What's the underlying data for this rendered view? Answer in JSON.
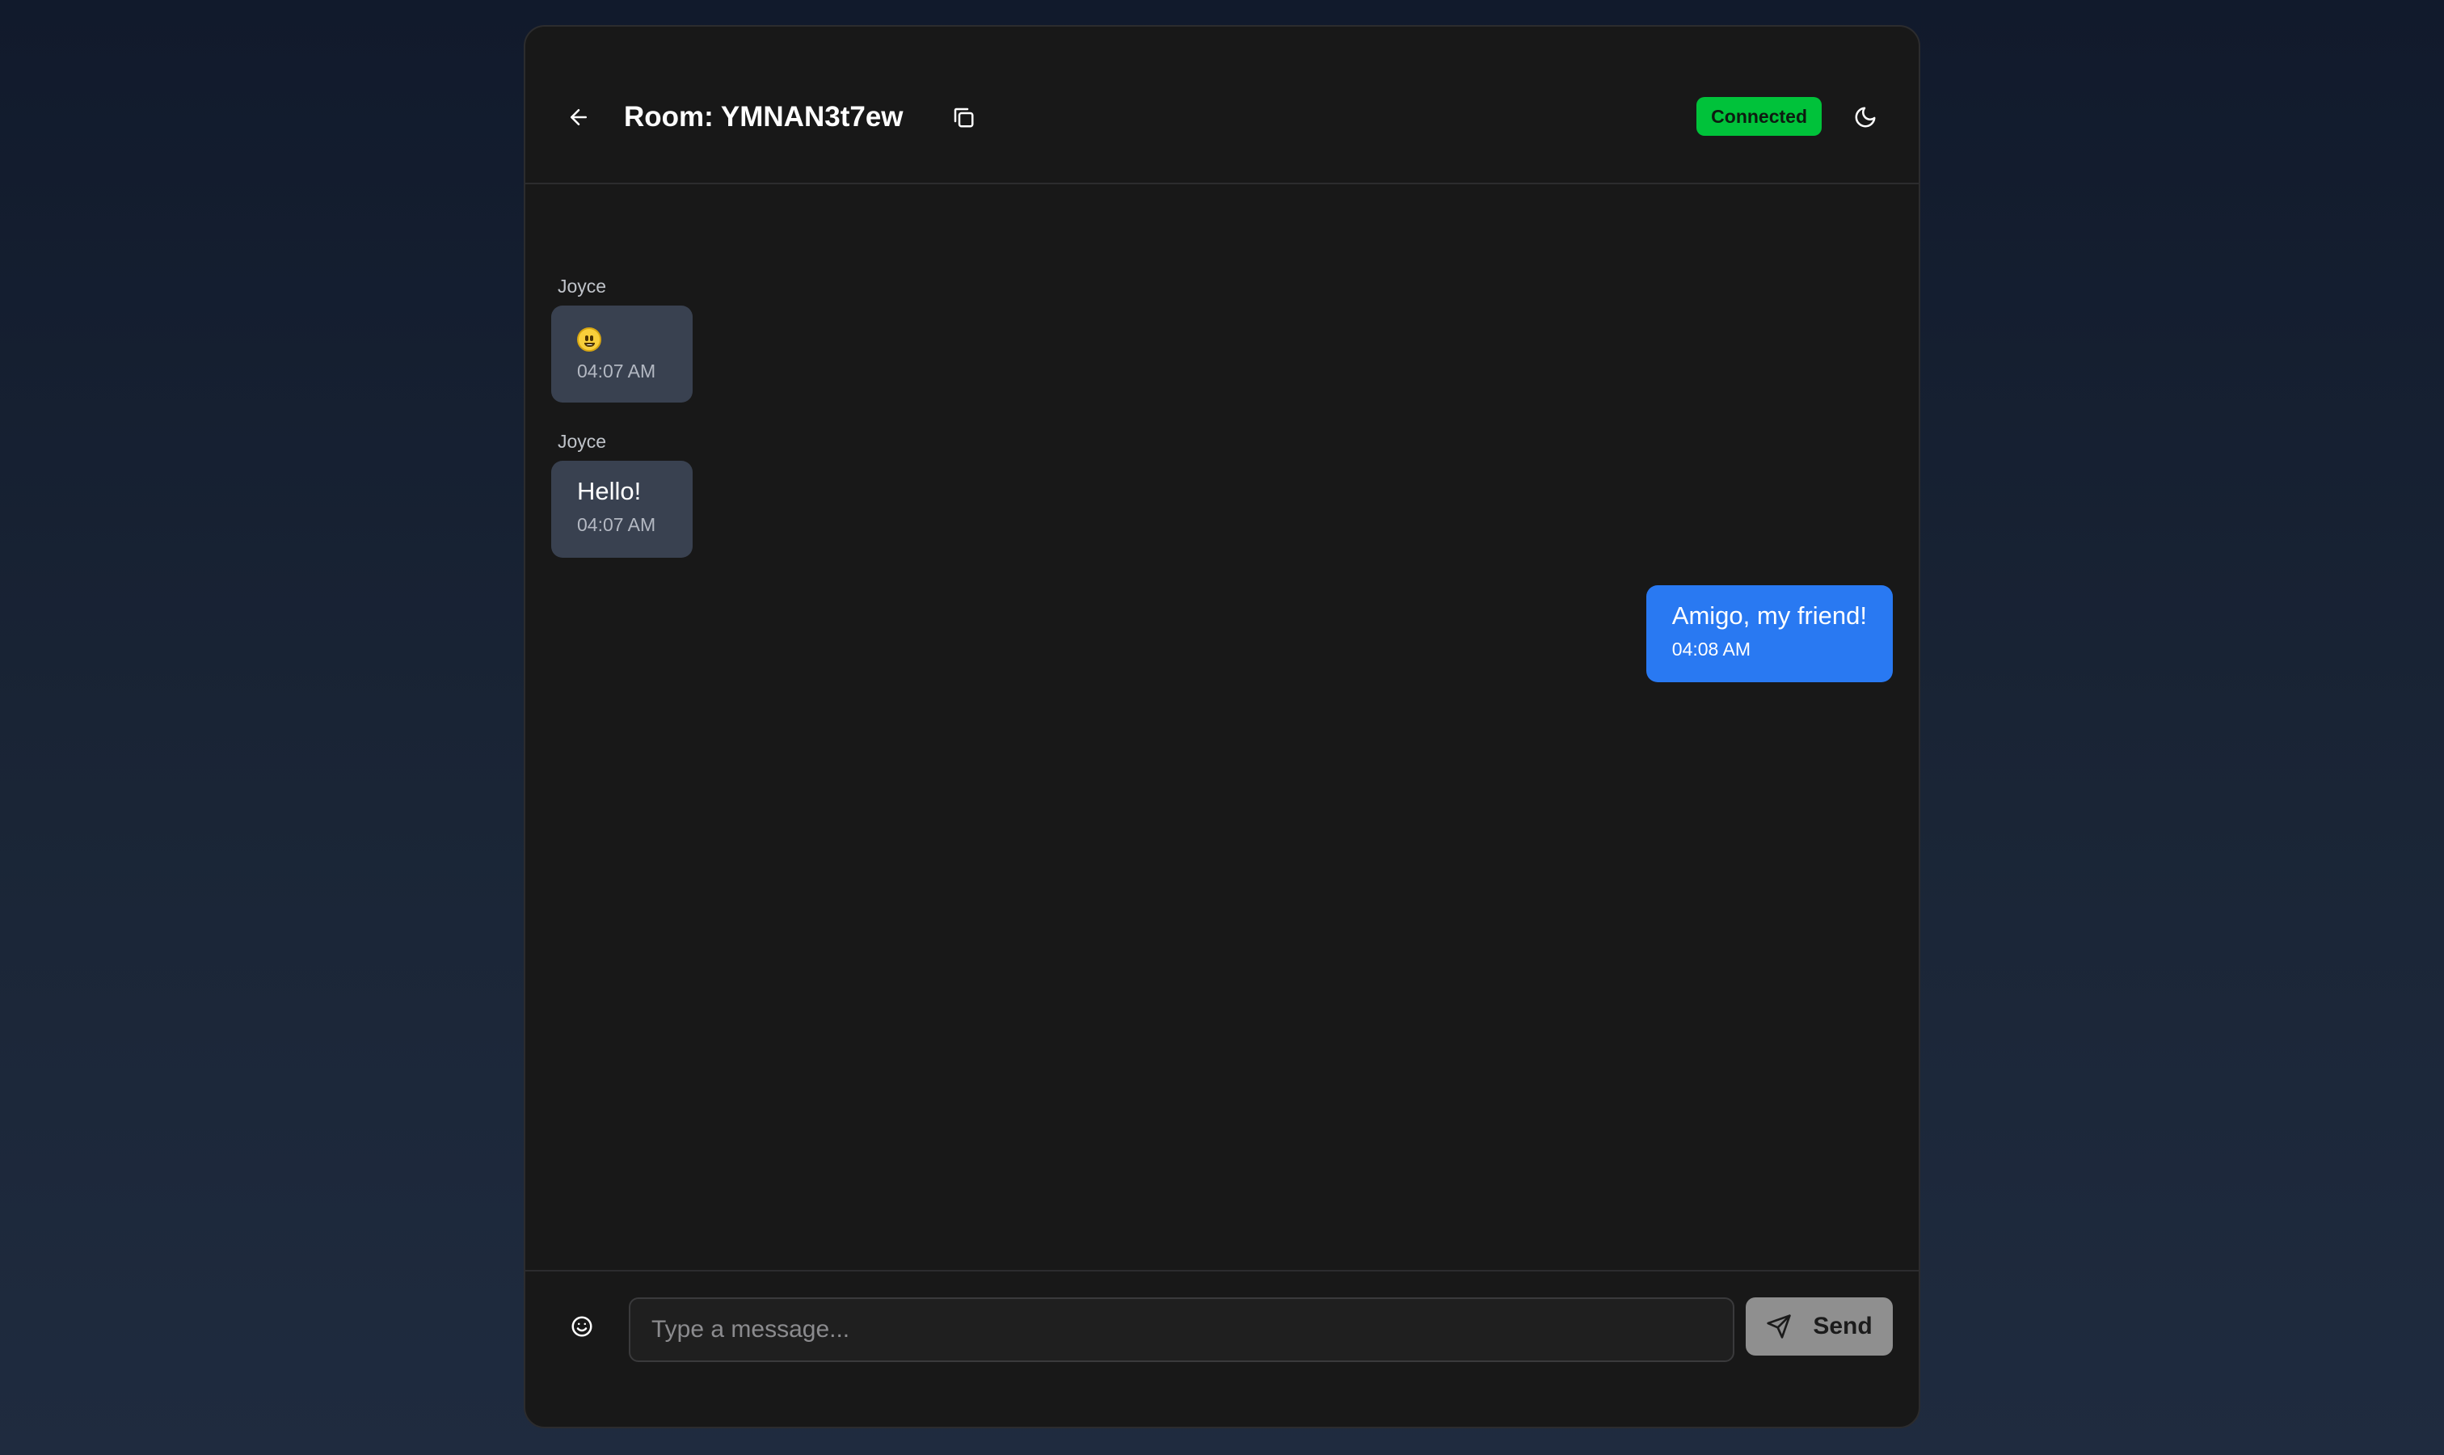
{
  "header": {
    "room_title": "Room: YMNAN3t7ew",
    "status": "Connected",
    "back_icon": "arrow-left-icon",
    "copy_icon": "copy-icon",
    "theme_icon": "moon-icon"
  },
  "messages": [
    {
      "sender": "Joyce",
      "text": "😃",
      "time": "04:07 AM",
      "direction": "incoming"
    },
    {
      "sender": "Joyce",
      "text": "Hello!",
      "time": "04:07 AM",
      "direction": "incoming"
    },
    {
      "sender": "",
      "text": "Amigo, my friend!",
      "time": "04:08 AM",
      "direction": "outgoing"
    }
  ],
  "composer": {
    "placeholder": "Type a message...",
    "value": "",
    "send_label": "Send",
    "emoji_icon": "smile-icon",
    "send_icon": "send-icon"
  },
  "colors": {
    "connected": "#00c23a",
    "outgoing_bubble": "#2979f2",
    "incoming_bubble": "#394150",
    "card_background": "#181818"
  }
}
